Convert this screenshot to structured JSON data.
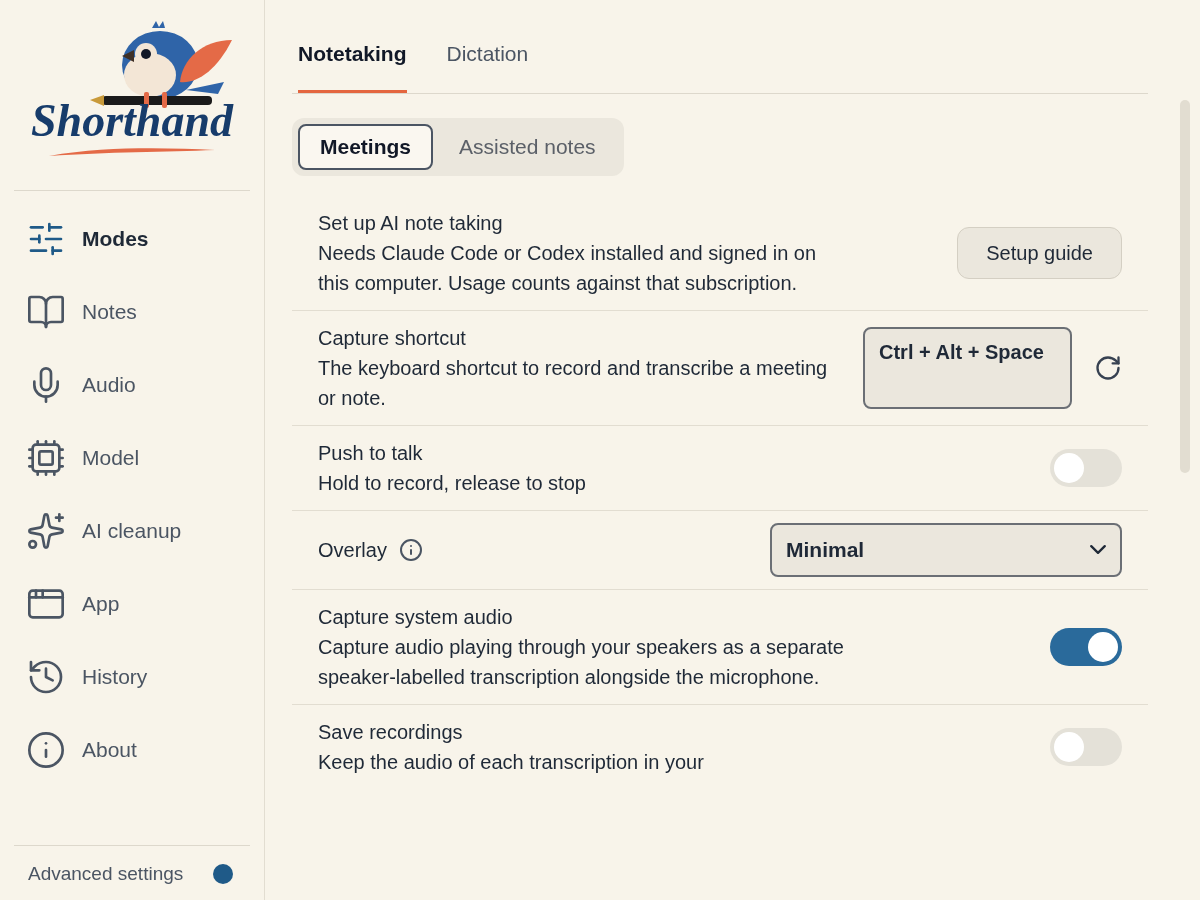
{
  "logo": {
    "text": "Shorthand"
  },
  "sidebar": {
    "items": [
      {
        "label": "Modes",
        "selected": true
      },
      {
        "label": "Notes",
        "selected": false
      },
      {
        "label": "Audio",
        "selected": false
      },
      {
        "label": "Model",
        "selected": false
      },
      {
        "label": "AI cleanup",
        "selected": false
      },
      {
        "label": "App",
        "selected": false
      },
      {
        "label": "History",
        "selected": false
      },
      {
        "label": "About",
        "selected": false
      }
    ],
    "footer": {
      "label": "Advanced settings"
    }
  },
  "tabs": [
    {
      "label": "Notetaking",
      "selected": true
    },
    {
      "label": "Dictation",
      "selected": false
    }
  ],
  "segments": [
    {
      "label": "Meetings",
      "selected": true
    },
    {
      "label": "Assisted notes",
      "selected": false
    }
  ],
  "settings": [
    {
      "kind": "button",
      "title": "Set up AI note taking",
      "description": "Needs Claude Code or Codex installed and signed in on this computer. Usage counts against that subscription.",
      "button": "Setup guide"
    },
    {
      "kind": "shortcut",
      "title": "Capture shortcut",
      "description": "The keyboard shortcut to record and transcribe a meeting or note.",
      "value": "Ctrl + Alt + Space"
    },
    {
      "kind": "toggle",
      "title": "Push to talk",
      "description": "Hold to record, release to stop",
      "on": false
    },
    {
      "kind": "select",
      "title": "Overlay",
      "info": true,
      "value": "Minimal"
    },
    {
      "kind": "toggle",
      "title": "Capture system audio",
      "description": "Capture audio playing through your speakers as a separate speaker-labelled transcription alongside the microphone.",
      "on": true
    },
    {
      "kind": "toggle",
      "title": "Save recordings",
      "description": "Keep the audio of each transcription in your",
      "on": false
    }
  ]
}
